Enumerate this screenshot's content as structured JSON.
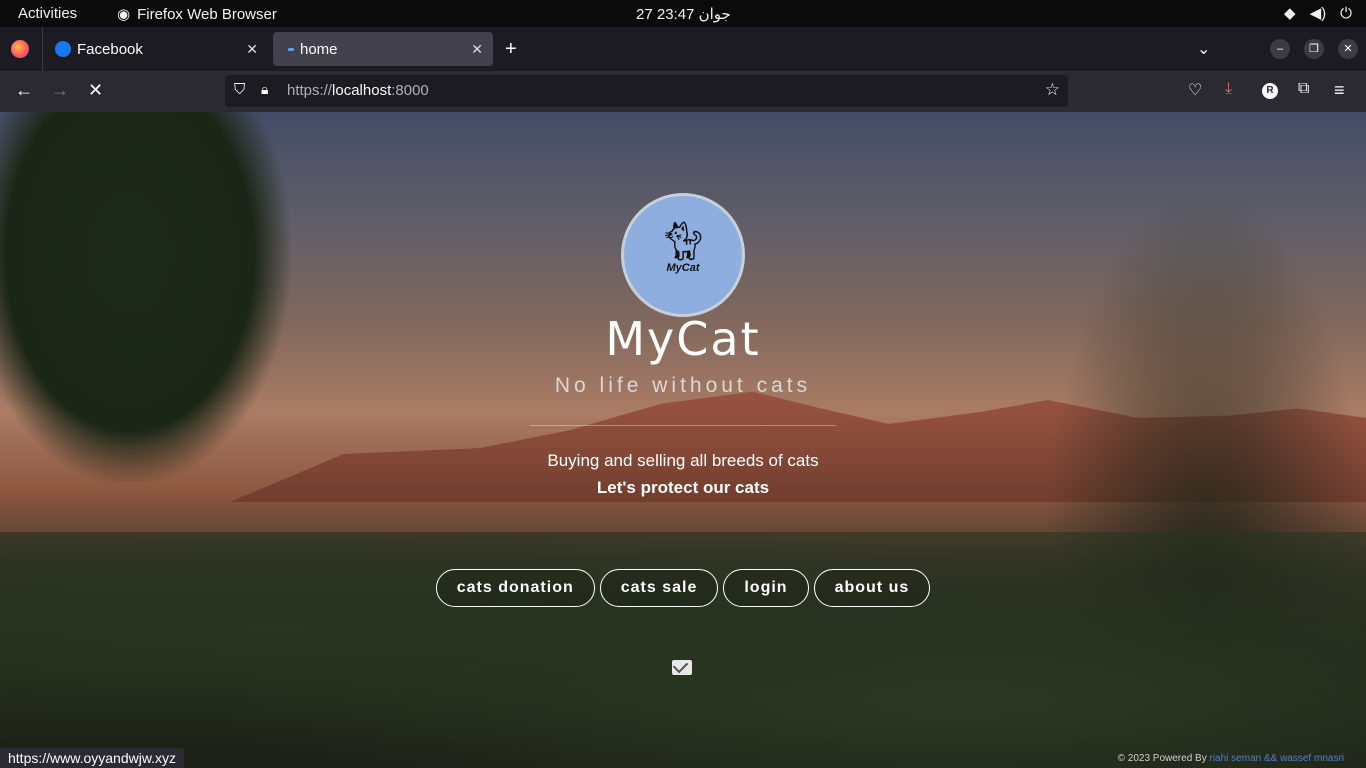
{
  "system": {
    "activities": "Activities",
    "app_name": "Firefox Web Browser",
    "clock": "27 جوان  23:47"
  },
  "tabs": [
    {
      "title": "Facebook",
      "close": "✕"
    },
    {
      "title": "home",
      "close": "✕"
    }
  ],
  "toolbar": {
    "new_tab": "+",
    "back": "←",
    "forward": "→",
    "stop": "✕",
    "url_scheme": "https://",
    "url_host": "localhost",
    "url_port": ":8000",
    "account_initial": "R"
  },
  "page": {
    "logo_text": "MyCat",
    "title": "MyCat",
    "tagline": "No life without cats",
    "desc_line1": "Buying and selling all breeds of cats",
    "desc_line2": "Let's protect our cats",
    "nav": [
      "cats donation",
      "cats sale",
      "login",
      "about us"
    ],
    "footer_prefix": "© 2023 Powered By ",
    "footer_authors": "riahi seman && wassef mnasri"
  },
  "status_url": "https://www.oyyandwjw.xyz"
}
